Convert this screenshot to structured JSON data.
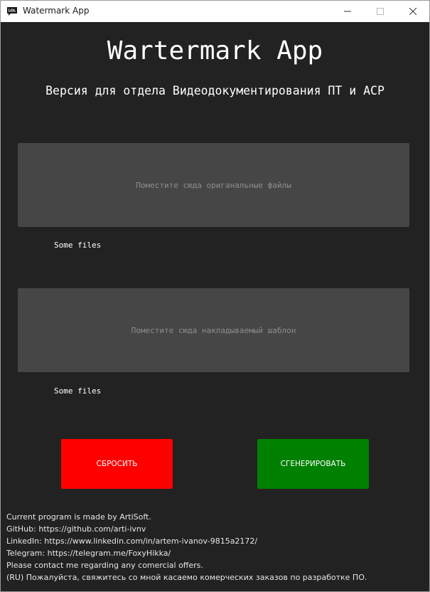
{
  "window": {
    "title": "Watermark App",
    "icon_label": "LOL",
    "controls": {
      "minimize": "—",
      "maximize": "☐",
      "close": "✕"
    }
  },
  "header": {
    "title": "Wartermark App",
    "subtitle": "Версия для отдела Видеодокументирования ПТ и АСР"
  },
  "dropzones": {
    "originals": {
      "placeholder": "Поместите сюда ориганальные файлы",
      "files_label": "Some files"
    },
    "template": {
      "placeholder": "Поместите сюда накладываемый шаблон",
      "files_label": "Some files"
    }
  },
  "buttons": {
    "reset_label": "СБРОСИТЬ",
    "reset_color": "#ff0000",
    "generate_label": "СГЕНЕРИРОВАТЬ",
    "generate_color": "#008000"
  },
  "footer": {
    "lines": [
      "Current program is made by ArtiSoft.",
      "GitHub: https://github.com/arti-ivnv",
      "LinkedIn: https://www.linkedin.com/in/artem-ivanov-9815a2172/",
      "Telegram: https://telegram.me/FoxyHikka/",
      "Please contact me regarding any comercial offers.",
      "(RU) Пожалуйста, свяжитесь со мной касаемо комерческих заказов по разработке ПО."
    ]
  }
}
